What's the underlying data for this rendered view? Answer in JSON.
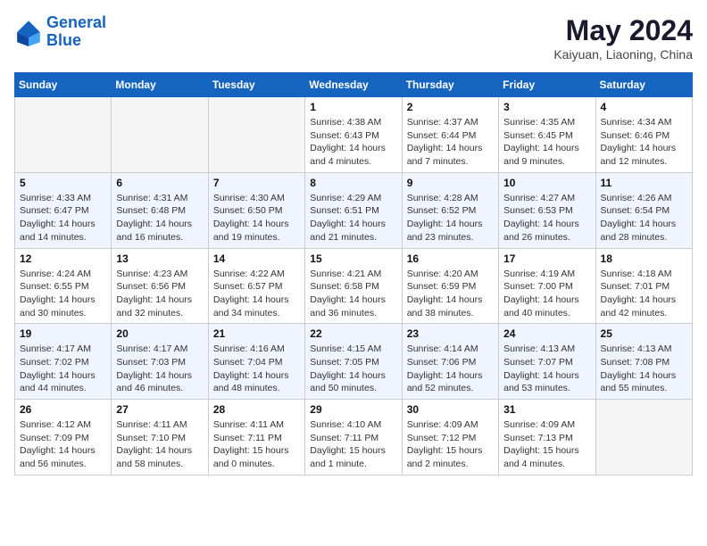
{
  "header": {
    "logo_line1": "General",
    "logo_line2": "Blue",
    "month_title": "May 2024",
    "subtitle": "Kaiyuan, Liaoning, China"
  },
  "days_of_week": [
    "Sunday",
    "Monday",
    "Tuesday",
    "Wednesday",
    "Thursday",
    "Friday",
    "Saturday"
  ],
  "weeks": [
    [
      {
        "day": "",
        "empty": true
      },
      {
        "day": "",
        "empty": true
      },
      {
        "day": "",
        "empty": true
      },
      {
        "day": "1",
        "sunrise": "4:38 AM",
        "sunset": "6:43 PM",
        "daylight": "14 hours and 4 minutes."
      },
      {
        "day": "2",
        "sunrise": "4:37 AM",
        "sunset": "6:44 PM",
        "daylight": "14 hours and 7 minutes."
      },
      {
        "day": "3",
        "sunrise": "4:35 AM",
        "sunset": "6:45 PM",
        "daylight": "14 hours and 9 minutes."
      },
      {
        "day": "4",
        "sunrise": "4:34 AM",
        "sunset": "6:46 PM",
        "daylight": "14 hours and 12 minutes."
      }
    ],
    [
      {
        "day": "5",
        "sunrise": "4:33 AM",
        "sunset": "6:47 PM",
        "daylight": "14 hours and 14 minutes."
      },
      {
        "day": "6",
        "sunrise": "4:31 AM",
        "sunset": "6:48 PM",
        "daylight": "14 hours and 16 minutes."
      },
      {
        "day": "7",
        "sunrise": "4:30 AM",
        "sunset": "6:50 PM",
        "daylight": "14 hours and 19 minutes."
      },
      {
        "day": "8",
        "sunrise": "4:29 AM",
        "sunset": "6:51 PM",
        "daylight": "14 hours and 21 minutes."
      },
      {
        "day": "9",
        "sunrise": "4:28 AM",
        "sunset": "6:52 PM",
        "daylight": "14 hours and 23 minutes."
      },
      {
        "day": "10",
        "sunrise": "4:27 AM",
        "sunset": "6:53 PM",
        "daylight": "14 hours and 26 minutes."
      },
      {
        "day": "11",
        "sunrise": "4:26 AM",
        "sunset": "6:54 PM",
        "daylight": "14 hours and 28 minutes."
      }
    ],
    [
      {
        "day": "12",
        "sunrise": "4:24 AM",
        "sunset": "6:55 PM",
        "daylight": "14 hours and 30 minutes."
      },
      {
        "day": "13",
        "sunrise": "4:23 AM",
        "sunset": "6:56 PM",
        "daylight": "14 hours and 32 minutes."
      },
      {
        "day": "14",
        "sunrise": "4:22 AM",
        "sunset": "6:57 PM",
        "daylight": "14 hours and 34 minutes."
      },
      {
        "day": "15",
        "sunrise": "4:21 AM",
        "sunset": "6:58 PM",
        "daylight": "14 hours and 36 minutes."
      },
      {
        "day": "16",
        "sunrise": "4:20 AM",
        "sunset": "6:59 PM",
        "daylight": "14 hours and 38 minutes."
      },
      {
        "day": "17",
        "sunrise": "4:19 AM",
        "sunset": "7:00 PM",
        "daylight": "14 hours and 40 minutes."
      },
      {
        "day": "18",
        "sunrise": "4:18 AM",
        "sunset": "7:01 PM",
        "daylight": "14 hours and 42 minutes."
      }
    ],
    [
      {
        "day": "19",
        "sunrise": "4:17 AM",
        "sunset": "7:02 PM",
        "daylight": "14 hours and 44 minutes."
      },
      {
        "day": "20",
        "sunrise": "4:17 AM",
        "sunset": "7:03 PM",
        "daylight": "14 hours and 46 minutes."
      },
      {
        "day": "21",
        "sunrise": "4:16 AM",
        "sunset": "7:04 PM",
        "daylight": "14 hours and 48 minutes."
      },
      {
        "day": "22",
        "sunrise": "4:15 AM",
        "sunset": "7:05 PM",
        "daylight": "14 hours and 50 minutes."
      },
      {
        "day": "23",
        "sunrise": "4:14 AM",
        "sunset": "7:06 PM",
        "daylight": "14 hours and 52 minutes."
      },
      {
        "day": "24",
        "sunrise": "4:13 AM",
        "sunset": "7:07 PM",
        "daylight": "14 hours and 53 minutes."
      },
      {
        "day": "25",
        "sunrise": "4:13 AM",
        "sunset": "7:08 PM",
        "daylight": "14 hours and 55 minutes."
      }
    ],
    [
      {
        "day": "26",
        "sunrise": "4:12 AM",
        "sunset": "7:09 PM",
        "daylight": "14 hours and 56 minutes."
      },
      {
        "day": "27",
        "sunrise": "4:11 AM",
        "sunset": "7:10 PM",
        "daylight": "14 hours and 58 minutes."
      },
      {
        "day": "28",
        "sunrise": "4:11 AM",
        "sunset": "7:11 PM",
        "daylight": "15 hours and 0 minutes."
      },
      {
        "day": "29",
        "sunrise": "4:10 AM",
        "sunset": "7:11 PM",
        "daylight": "15 hours and 1 minute."
      },
      {
        "day": "30",
        "sunrise": "4:09 AM",
        "sunset": "7:12 PM",
        "daylight": "15 hours and 2 minutes."
      },
      {
        "day": "31",
        "sunrise": "4:09 AM",
        "sunset": "7:13 PM",
        "daylight": "15 hours and 4 minutes."
      },
      {
        "day": "",
        "empty": true
      }
    ]
  ]
}
